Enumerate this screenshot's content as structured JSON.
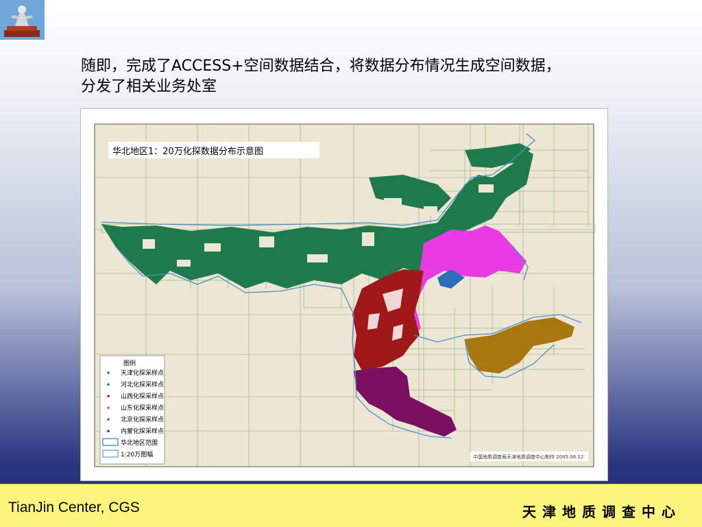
{
  "slide": {
    "title_line1": "随即，完成了ACCESS+空间数据结合，将数据分布情况生成空间数据，",
    "title_line2": "分发了相关业务处室"
  },
  "map": {
    "title": "华北地区1：20万化探数据分布示意图",
    "legend_title": "图例",
    "legend_items": [
      {
        "label": "天津化探采样点",
        "color": "#2c6fb8"
      },
      {
        "label": "河北化探采样点",
        "color": "#1e7a4a"
      },
      {
        "label": "山西化探采样点",
        "color": "#c21818"
      },
      {
        "label": "山东化探采样点",
        "color": "#b07a10"
      },
      {
        "label": "北京化探采样点",
        "color": "#3a5fc4"
      },
      {
        "label": "内蒙化探采样点",
        "color": "#7a1060"
      },
      {
        "label": "华北地区范围",
        "color": "#4a8fd0"
      },
      {
        "label": "1:20万图幅",
        "color": "#7fa6d8"
      }
    ],
    "credit": "中国地质调查局天津地质调查中心制作  2005.06.12",
    "colors": {
      "background": "#ede6d2",
      "hebei": "#1e7a4a",
      "tianjin_beijing": "#e83be6",
      "shanxi": "#a01818",
      "neimeng": "#7a1060",
      "shandong": "#a8770f",
      "boundary": "#4a8fd0",
      "grid": "#8fbf8f"
    }
  },
  "footer": {
    "left": "TianJin Center, CGS",
    "right": "天津地质调查中心"
  }
}
